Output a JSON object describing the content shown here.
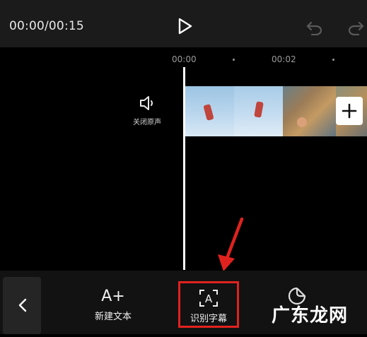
{
  "player": {
    "time": "00:00/00:15",
    "play_icon": "play-icon",
    "undo_icon": "undo-icon",
    "redo_icon": "redo-icon"
  },
  "ruler": {
    "labels": [
      "00:00",
      "00:02"
    ]
  },
  "track": {
    "mute_label": "关闭原声",
    "mute_icon": "speaker-icon",
    "add_icon": "plus-icon"
  },
  "toolbar": {
    "back_icon": "chevron-left-icon",
    "items": [
      {
        "label": "新建文本",
        "icon_text": "A+",
        "icon": "text-add-icon"
      },
      {
        "label": "识别字幕",
        "icon_text": "A",
        "icon": "subtitle-recognize-icon"
      },
      {
        "label": "",
        "icon": "sticker-icon"
      }
    ]
  },
  "annotation": {
    "arrow_color": "#e0221e",
    "highlight_color": "#e0221e"
  },
  "watermark": "广东龙网"
}
